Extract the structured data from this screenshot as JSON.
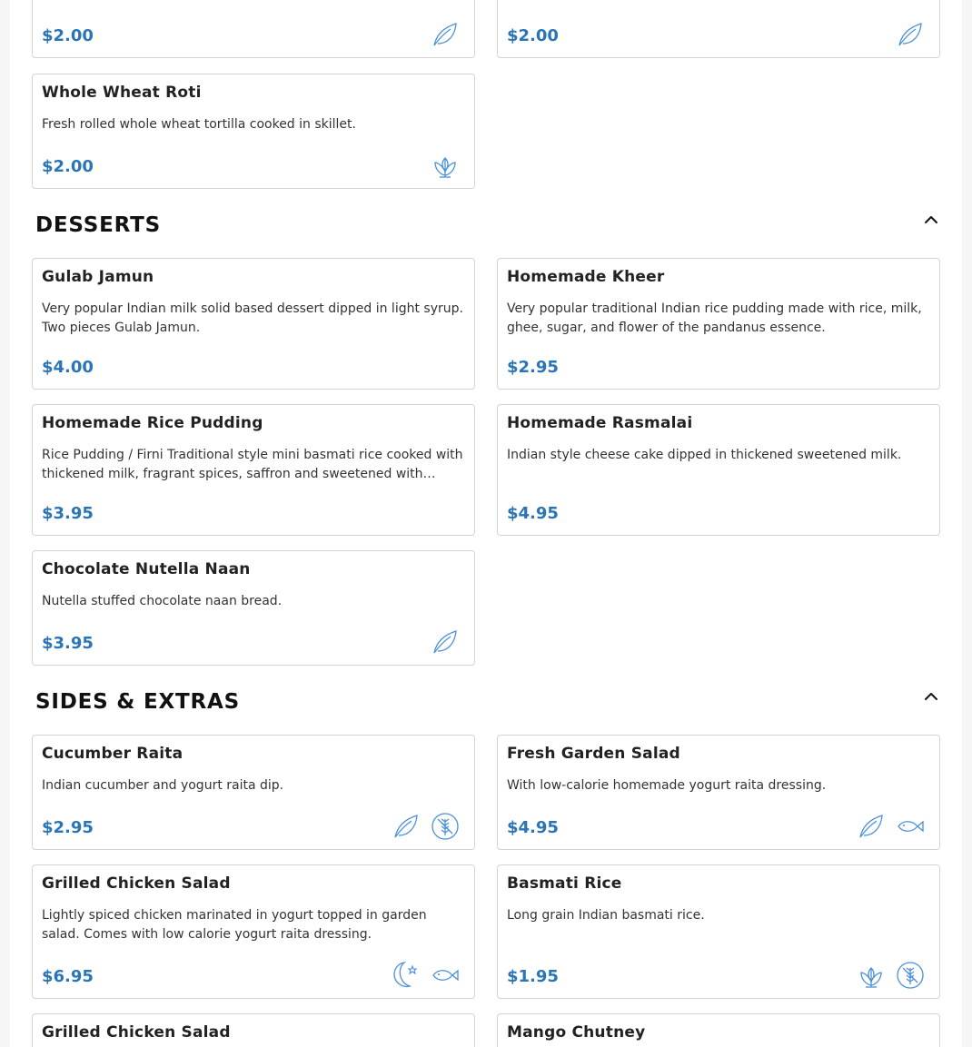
{
  "colors": {
    "accent": "#2a74b8",
    "card_border": "#d4d4d4",
    "icon": "#4a90d9"
  },
  "breads_partial": [
    {
      "price": "$2.00",
      "icons": [
        "vegetarian-leaf-icon"
      ]
    },
    {
      "price": "$2.00",
      "icons": [
        "vegetarian-leaf-icon"
      ]
    }
  ],
  "breads": [
    {
      "name": "Whole Wheat Roti",
      "description": "Fresh rolled whole wheat tortilla cooked in skillet.",
      "price": "$2.00",
      "icons": [
        "vegan-plant-icon"
      ]
    }
  ],
  "desserts": {
    "title": "DESSERTS",
    "items": [
      {
        "name": "Gulab Jamun",
        "description": "Very popular Indian milk solid based dessert dipped in light syrup. Two pieces Gulab Jamun.",
        "price": "$4.00",
        "icons": []
      },
      {
        "name": "Homemade Kheer",
        "description": "Very popular traditional Indian rice pudding made with rice, milk, ghee, sugar, and flower of the pandanus essence.",
        "price": "$2.95",
        "icons": []
      },
      {
        "name": "Homemade Rice Pudding",
        "description": "Rice Pudding / Firni Traditional style mini basmati rice cooked with thickened milk, fragrant spices, saffron and sweetened with candied fruit.",
        "price": "$3.95",
        "icons": []
      },
      {
        "name": "Homemade Rasmalai",
        "description": "Indian style cheese cake dipped in thickened sweetened milk.",
        "price": "$4.95",
        "icons": []
      },
      {
        "name": "Chocolate Nutella Naan",
        "description": "Nutella stuffed chocolate naan bread.",
        "price": "$3.95",
        "icons": [
          "vegetarian-leaf-icon"
        ]
      }
    ]
  },
  "sides": {
    "title": "SIDES & EXTRAS",
    "items": [
      {
        "name": "Cucumber Raita",
        "description": "Indian cucumber and yogurt raita dip.",
        "price": "$2.95",
        "icons": [
          "vegetarian-leaf-icon",
          "gluten-free-icon"
        ]
      },
      {
        "name": "Fresh Garden Salad",
        "description": "With low-calorie homemade yogurt raita dressing.",
        "price": "$4.95",
        "icons": [
          "vegetarian-leaf-icon",
          "fish-icon"
        ]
      },
      {
        "name": "Grilled Chicken Salad",
        "description": "Lightly spiced chicken marinated in yogurt topped in garden salad. Comes with low calorie yogurt raita dressing.",
        "price": "$6.95",
        "icons": [
          "halal-moon-icon",
          "fish-icon"
        ]
      },
      {
        "name": "Basmati Rice",
        "description": "Long grain Indian basmati rice.",
        "price": "$1.95",
        "icons": [
          "vegan-plant-icon",
          "gluten-free-icon"
        ]
      },
      {
        "name": "Grilled Chicken Salad",
        "description": "",
        "price": "",
        "icons": []
      },
      {
        "name": "Mango Chutney",
        "description": "",
        "price": "",
        "icons": []
      }
    ]
  }
}
